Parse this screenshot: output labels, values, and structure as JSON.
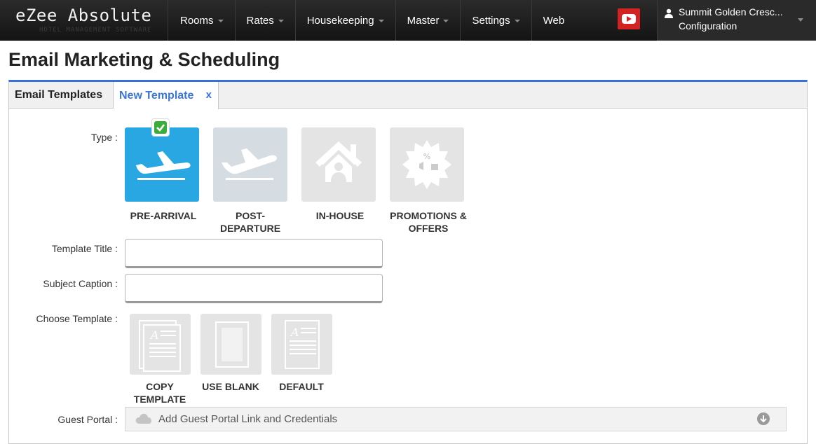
{
  "app": {
    "logo": "eZee Absolute",
    "logo_sub": "HOTEL MANAGEMENT SOFTWARE"
  },
  "nav": {
    "rooms": "Rooms",
    "rates": "Rates",
    "housekeeping": "Housekeeping",
    "master": "Master",
    "settings": "Settings",
    "web": "Web"
  },
  "user": {
    "name": "Summit Golden Cresc...",
    "role": "Configuration"
  },
  "page": {
    "title": "Email Marketing & Scheduling"
  },
  "tabs": {
    "email_templates": "Email Templates",
    "new_template": "New Template",
    "close": "x"
  },
  "form": {
    "type_label": "Type :",
    "template_title_label": "Template Title :",
    "subject_caption_label": "Subject Caption :",
    "choose_template_label": "Choose Template :",
    "guest_portal_label": "Guest Portal :",
    "template_title_value": "",
    "subject_caption_value": ""
  },
  "types": {
    "pre_arrival": "PRE-ARRIVAL",
    "post_departure": "POST-\nDEPARTURE",
    "in_house": "IN-HOUSE",
    "promotions": "PROMOTIONS &\nOFFERS",
    "selected": "PRE-ARRIVAL"
  },
  "templates": {
    "copy": "COPY\nTEMPLATE",
    "blank": "USE BLANK",
    "default": "DEFAULT"
  },
  "guest_portal": {
    "text": "Add Guest Portal Link and Credentials"
  },
  "colors": {
    "accent": "#3a6fd8",
    "selected_tile": "#29a7e2",
    "tile_inactive": "#dde0e4",
    "check": "#3aae3a",
    "youtube": "#d32222"
  }
}
